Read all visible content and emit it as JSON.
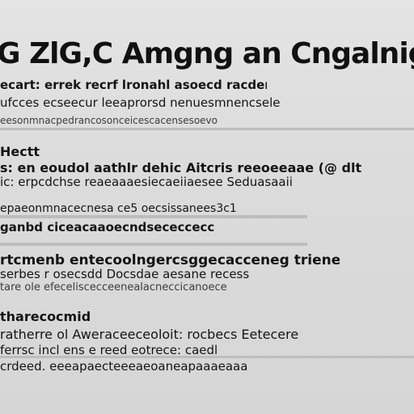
{
  "title": "G ZlG,C Amgng an Cngalnig",
  "lines": [
    "ecart: errek recrf lronahl asoecd racder",
    "ufcces ecseecur leeaprorsd nenuesmnencsele",
    "eesonmnacpedrancosonceicescacensesoevo",
    "Hectt",
    "s: en eoudol aathlr dehic Aitcris reeoeeaae (@ dlt",
    "ic: erpcdchse reaeaaaesiecaeiiaesee Seduasaaii",
    "epaeonmnacecnesa ce5 oecsissanees3c1",
    "ganbd ciceacaaoecndsececcecc",
    "rtcmenb entecoolngercsggecacceneg triene",
    "serbes r osecsdd Docsdae aesane recess",
    "tare ole efeceliscecceenealacneccicanoece",
    "tharecocmid",
    "ratherre ol Aweraceeceoloit: rocbecs Eetecere",
    "ferrsc incl ens e reed eotrece: caedl",
    "crdeed. eeeapaecteeeaeoaneapaaaeaaa"
  ]
}
